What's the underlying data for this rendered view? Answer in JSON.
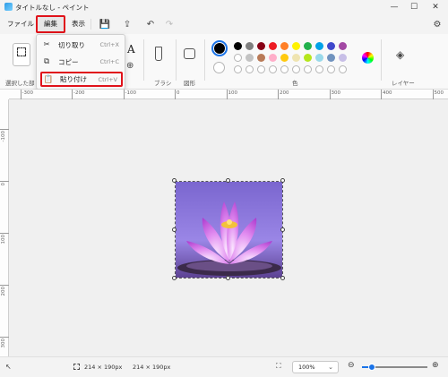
{
  "window": {
    "title": "タイトルなし - ペイント",
    "minimize": "—",
    "maximize": "☐",
    "close": "✕"
  },
  "menu": {
    "file": "ファイル",
    "edit": "編集",
    "view": "表示"
  },
  "ribbon": {
    "selection_label": "選択した部",
    "brush_label": "ブラシ",
    "shape_label": "図形",
    "color_label": "色",
    "layer_label": "レイヤー",
    "text_tool": "A"
  },
  "edit_menu": {
    "items": [
      {
        "label": "切り取り",
        "shortcut": "Ctrl+X"
      },
      {
        "label": "コピー",
        "shortcut": "Ctrl+C"
      },
      {
        "label": "貼り付け",
        "shortcut": "Ctrl+V"
      }
    ]
  },
  "ruler": {
    "h": [
      "-300",
      "-200",
      "-100",
      "0",
      "100",
      "200",
      "300",
      "400",
      "500"
    ],
    "v": [
      "-100",
      "0",
      "100",
      "200",
      "300"
    ]
  },
  "colors": {
    "row1": [
      "#000000",
      "#7f7f7f",
      "#880015",
      "#ed1c24",
      "#ff7f27",
      "#fff200",
      "#22b14c",
      "#00a2e8",
      "#3f48cc",
      "#a349a4"
    ],
    "row2": [
      "#ffffff",
      "#c3c3c3",
      "#b97a57",
      "#ffaec9",
      "#ffc90e",
      "#efe4b0",
      "#b5e61d",
      "#99d9ea",
      "#7092be",
      "#c8bfe7"
    ],
    "primary": "#000000",
    "secondary": "#ffffff"
  },
  "status": {
    "selection_size": "214 × 190px",
    "image_size": "214 × 190px",
    "zoom": "100%"
  }
}
